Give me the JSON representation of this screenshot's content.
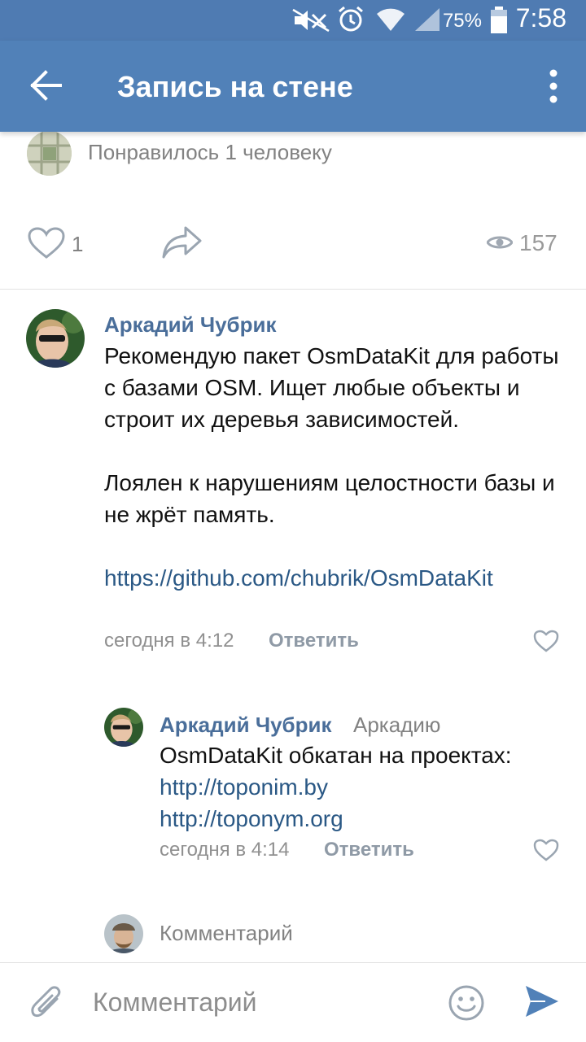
{
  "status_bar": {
    "battery_percent": "75%",
    "time": "7:58",
    "icons": [
      "mute-icon",
      "alarm-icon",
      "wifi-icon",
      "signal-icon",
      "battery-icon"
    ]
  },
  "app_bar": {
    "title": "Запись на стене",
    "back_icon": "arrow-left-icon",
    "more_icon": "more-vertical-icon"
  },
  "post": {
    "liked_text": "Понравилось 1 человеку",
    "likes_count": "1",
    "views_count": "157"
  },
  "comments": [
    {
      "author": "Аркадий Чубрик",
      "paragraph1": "Рекомендую пакет OsmDataKit для работы с базами OSM. Ищет любые объекты и строит их деревья зависимостей.",
      "paragraph2": "Лоялен к нарушениям целостности базы и не жрёт память.",
      "link": "https://github.com/chubrik/OsmDataKit",
      "time": "сегодня в 4:12",
      "reply_label": "Ответить"
    },
    {
      "author": "Аркадий Чубрик",
      "reply_to": "Аркадию",
      "text": "OsmDataKit обкатан на проектах:",
      "link1": "http://toponim.by",
      "link2": "http://toponym.org",
      "time": "сегодня в 4:14",
      "reply_label": "Ответить"
    }
  ],
  "inline_comment_placeholder": "Комментарий",
  "composer": {
    "placeholder": "Комментарий",
    "icons": [
      "attach-icon",
      "emoji-icon",
      "send-icon"
    ]
  },
  "colors": {
    "accent": "#5181b8",
    "link": "#2a5885",
    "author": "#4a6e9a"
  }
}
